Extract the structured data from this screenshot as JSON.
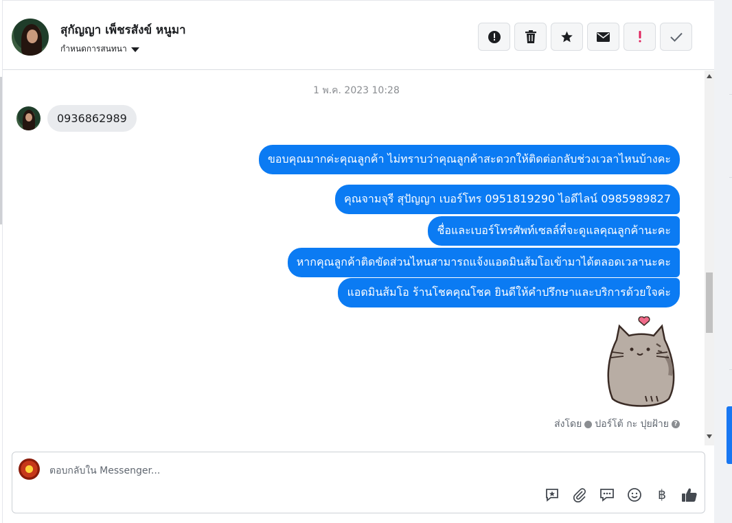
{
  "conversation": {
    "contact_name": "สุกัญญา เพ็ชรสังข์ หนูมา",
    "assign_label": "กำหนดการสนทนา"
  },
  "actions": [
    {
      "name": "mark-spam-button",
      "icon": "alert-circle-icon"
    },
    {
      "name": "delete-button",
      "icon": "trash-icon"
    },
    {
      "name": "star-button",
      "icon": "star-icon"
    },
    {
      "name": "mark-unread-button",
      "icon": "envelope-icon"
    },
    {
      "name": "follow-up-button",
      "icon": "exclamation-icon"
    },
    {
      "name": "mark-done-button",
      "icon": "check-icon"
    }
  ],
  "thread": {
    "timestamp": "1 พ.ค. 2023 10:28",
    "incoming": "0936862989",
    "outgoing": [
      "ขอบคุณมากค่ะคุณลูกค้า ไม่ทราบว่าคุณลูกค้าสะดวกให้ติดต่อกลับช่วงเวลาไหนบ้างคะ",
      "คุณจามจุรี สุปัญญา เบอร์โทร 0951819290  ไอดีไลน์ 0985989827",
      "ชื่อและเบอร์โทรศัพท์เซลล์ที่จะดูแลคุณลูกค้านะคะ",
      "หากคุณลูกค้าติดขัดส่วนไหนสามารถแจ้งแอดมินส้มโอเข้ามาได้ตลอดเวลานะคะ",
      "แอดมินส้มโอ ร้านโชคคุณโชค ยินดีให้คำปรึกษาและบริการด้วยใจค่ะ"
    ],
    "sent_by_prefix": "ส่งโดย",
    "sent_by_name": "ปอร์โต้ กะ ปุยฝ้าย",
    "help": "?"
  },
  "composer": {
    "placeholder": "ตอบกลับใน Messenger...",
    "tools": [
      "saved-reply-icon",
      "attachment-icon",
      "message-bubble-icon",
      "emoji-icon",
      "baht-icon",
      "like-icon"
    ],
    "baht_symbol": "฿"
  },
  "colors": {
    "outgoing_bubble": "#0b7bf3",
    "incoming_bubble": "#e9ebee",
    "accent": "#1877f2"
  }
}
